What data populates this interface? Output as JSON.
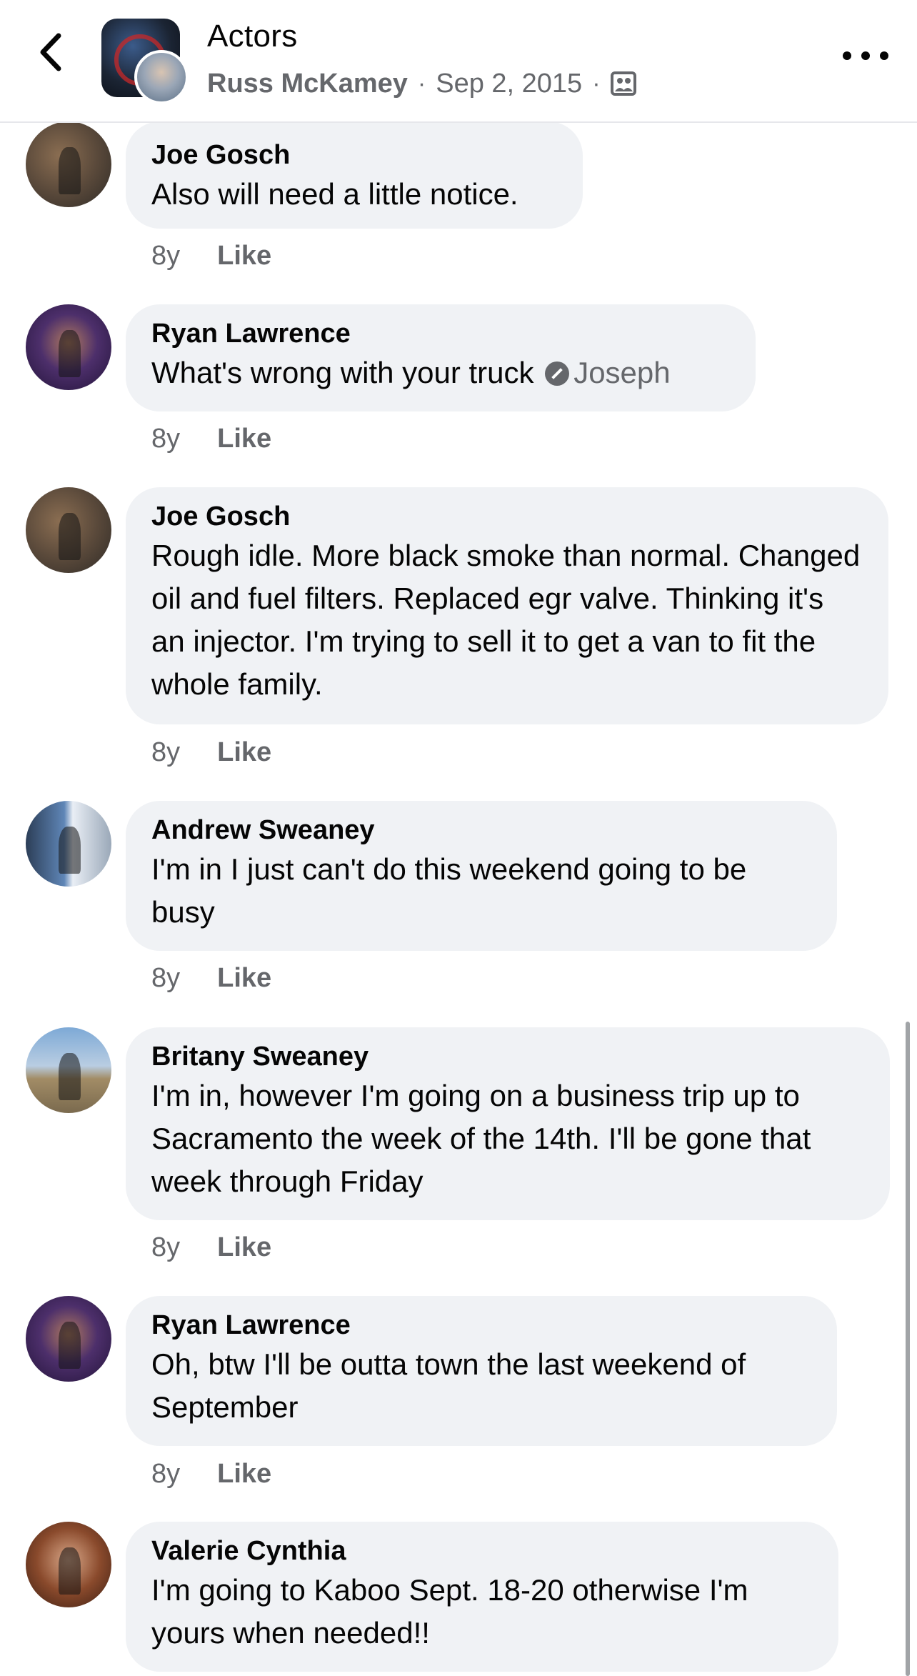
{
  "header": {
    "title": "Actors",
    "author": "Russ McKamey",
    "separator": "·",
    "date": "Sep 2, 2015",
    "back_icon": "chevron-left-icon",
    "more_icon": "more-horizontal-icon",
    "audience_icon": "group-audience-icon"
  },
  "comments": [
    {
      "name": "Joe Gosch",
      "text": "Also will need a little notice.",
      "time": "8y",
      "like": "Like"
    },
    {
      "name": "Ryan Lawrence",
      "text": "What's wrong with your truck",
      "mention": "Joseph",
      "time": "8y",
      "like": "Like"
    },
    {
      "name": "Joe Gosch",
      "text": "Rough idle. More black smoke than normal. Changed oil and fuel filters. Replaced egr valve. Thinking it's an injector. I'm trying to sell it to get a van to fit the whole family.",
      "time": "8y",
      "like": "Like"
    },
    {
      "name": "Andrew Sweaney",
      "text": "I'm in I just can't do this weekend going to be busy",
      "time": "8y",
      "like": "Like"
    },
    {
      "name": "Britany Sweaney",
      "text": "I'm in, however I'm going on a business trip up to Sacramento the week of the 14th. I'll be gone that week through Friday",
      "time": "8y",
      "like": "Like"
    },
    {
      "name": "Ryan Lawrence",
      "text": "Oh, btw I'll be outta town the last weekend of September",
      "time": "8y",
      "like": "Like"
    },
    {
      "name": "Valerie Cynthia",
      "text": "I'm going to Kaboo Sept. 18-20 otherwise I'm yours when needed!!"
    }
  ],
  "colors": {
    "bubble": "#f0f2f5",
    "meta_text": "#65676b",
    "primary_text": "#050505"
  }
}
